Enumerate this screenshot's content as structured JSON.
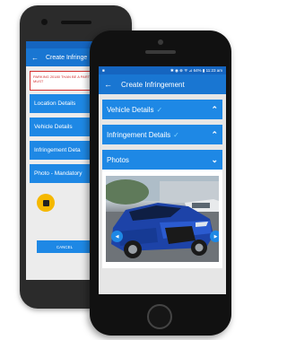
{
  "back_phone": {
    "app_title": "Create Infringe",
    "alert_text": "PARKING 20180 THAN BE A PART OF ALL FIELDS MUST",
    "sections": [
      {
        "label": "Location Details"
      },
      {
        "label": "Vehicle Details"
      },
      {
        "label": "Infringement Deta"
      },
      {
        "label": "Photo - Mandatory"
      }
    ],
    "cancel_label": "CANCEL"
  },
  "front_phone": {
    "status_left": "■",
    "status_right": "✱ ◉ ⊕ ᯤ ⊿ 64% ▮ 11:23 am",
    "app_title": "Create Infringement",
    "sections": [
      {
        "label": "Vehicle Details",
        "checked": "✓",
        "toggle": "⌃"
      },
      {
        "label": "Infringement Details",
        "checked": "✓",
        "toggle": "⌃"
      },
      {
        "label": "Photos",
        "checked": "",
        "toggle": "⌄"
      }
    ],
    "photo_nav_prev": "◀",
    "photo_nav_next": "▶"
  },
  "colors": {
    "primary": "#1976d2",
    "section": "#1e88e5",
    "alert_red": "#d32f2f",
    "fab_yellow": "#f5b800",
    "fab_green": "#43a047"
  }
}
